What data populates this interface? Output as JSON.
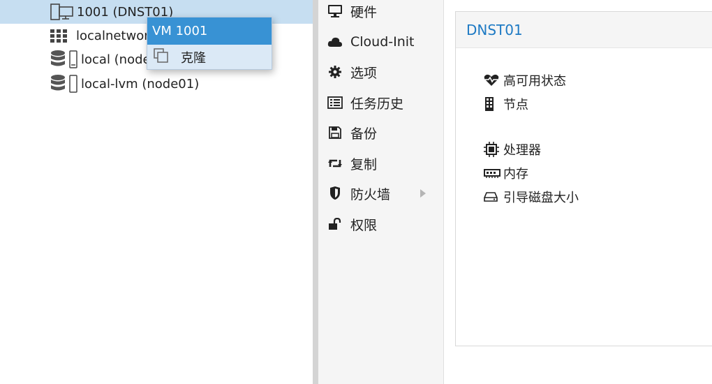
{
  "tree": {
    "items": [
      {
        "label": "1001 (DNST01)",
        "icon": "vm-icon",
        "selected": true
      },
      {
        "label": "localnetwork",
        "icon": "grid-icon"
      },
      {
        "label": "local (node01)",
        "icon": "storage-icon"
      },
      {
        "label": "local-lvm (node01)",
        "icon": "storage-icon"
      }
    ]
  },
  "context_menu": {
    "title": "VM 1001",
    "items": [
      {
        "label": "克隆",
        "icon": "clone-icon"
      }
    ]
  },
  "menu": {
    "items": [
      {
        "label": "硬件",
        "icon": "monitor-icon"
      },
      {
        "label": "Cloud-Init",
        "icon": "cloud-icon"
      },
      {
        "label": "选项",
        "icon": "gear-icon"
      },
      {
        "label": "任务历史",
        "icon": "list-icon"
      },
      {
        "label": "备份",
        "icon": "save-icon"
      },
      {
        "label": "复制",
        "icon": "retweet-icon"
      },
      {
        "label": "防火墙",
        "icon": "shield-icon",
        "has_submenu": true
      },
      {
        "label": "权限",
        "icon": "unlock-icon"
      }
    ]
  },
  "content": {
    "title": "DNST01",
    "properties": [
      {
        "label": "高可用状态",
        "icon": "heartbeat-icon"
      },
      {
        "label": "节点",
        "icon": "building-icon"
      },
      {
        "label": "处理器",
        "icon": "cpu-icon"
      },
      {
        "label": "内存",
        "icon": "memory-icon"
      },
      {
        "label": "引导磁盘大小",
        "icon": "hdd-icon"
      }
    ]
  },
  "colors": {
    "selected_row": "#c6def1",
    "context_title": "#3892d4",
    "accent_text": "#1e7ac4"
  }
}
